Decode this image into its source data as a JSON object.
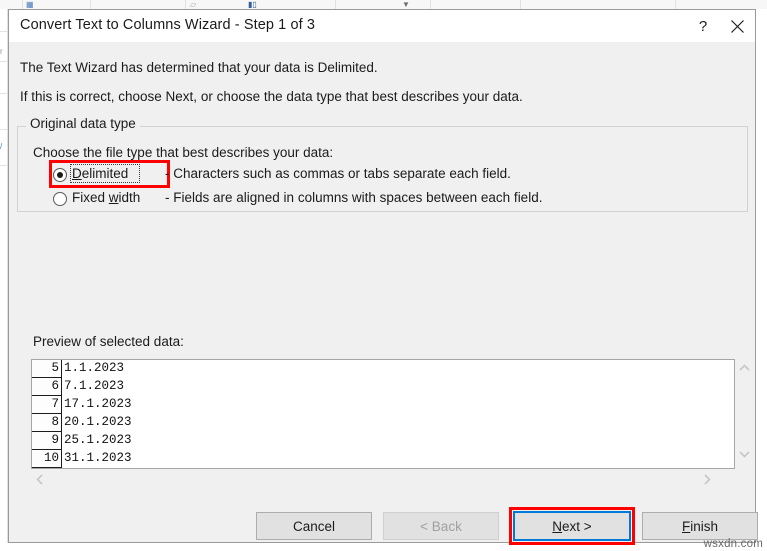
{
  "dialog": {
    "title": "Convert Text to Columns Wizard - Step 1 of 3",
    "help_icon": "?",
    "close_icon": "close-icon",
    "intro_line_1": "The Text Wizard has determined that your data is Delimited.",
    "intro_line_2": "If this is correct, choose Next, or choose the data type that best describes your data."
  },
  "original_data_type": {
    "legend": "Original data type",
    "instruction": "Choose the file type that best describes your data:",
    "options": [
      {
        "label": "Delimited",
        "accel": "D",
        "label_rest": "elimited",
        "description": "- Characters such as commas or tabs separate each field.",
        "selected": true,
        "focused": true,
        "highlighted": true
      },
      {
        "label": "Fixed width",
        "label_pre": "Fixed ",
        "accel": "w",
        "label_rest": "idth",
        "description": "- Fields are aligned in columns with spaces between each field.",
        "selected": false,
        "focused": false,
        "highlighted": false
      }
    ]
  },
  "preview": {
    "label": "Preview of selected data:",
    "rows": [
      {
        "number": "5",
        "value": "1.1.2023"
      },
      {
        "number": "6",
        "value": "7.1.2023"
      },
      {
        "number": "7",
        "value": "17.1.2023"
      },
      {
        "number": "8",
        "value": "20.1.2023"
      },
      {
        "number": "9",
        "value": "25.1.2023"
      },
      {
        "number": "10",
        "value": "31.1.2023"
      }
    ],
    "vertical_scrollbar": {
      "up_icon": "chevron-up-icon",
      "down_icon": "chevron-down-icon"
    },
    "horizontal_scrollbar": {
      "left_icon": "chevron-left-icon",
      "right_icon": "chevron-right-icon"
    }
  },
  "footer": {
    "cancel": "Cancel",
    "back": "< Back",
    "back_disabled": true,
    "next_pre": "",
    "next_accel": "N",
    "next_rest": "ext >",
    "next_highlighted": true,
    "next_default": true,
    "finish_accel": "F",
    "finish_rest": "inish"
  },
  "watermark": "wsxdn.com",
  "colors": {
    "highlight_red": "#ff0000",
    "default_button_blue": "#0078d7",
    "dialog_face": "#f0f0f0",
    "titlebar": "#ffffff",
    "text": "#1b1b1b",
    "disabled_text": "#a0a0a0"
  }
}
